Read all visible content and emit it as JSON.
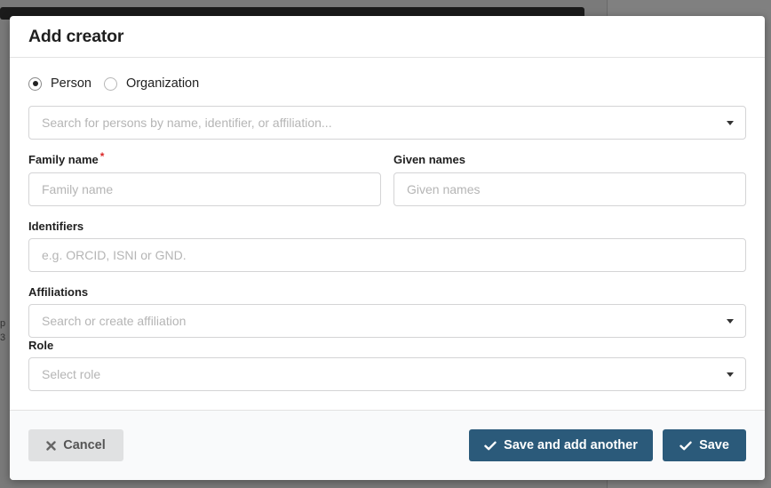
{
  "background": {
    "text_1": "p",
    "text_2": "3"
  },
  "modal": {
    "title": "Add creator",
    "type_options": [
      {
        "label": "Person",
        "checked": true
      },
      {
        "label": "Organization",
        "checked": false
      }
    ],
    "search": {
      "placeholder": "Search for persons by name, identifier, or affiliation..."
    },
    "family_name": {
      "label": "Family name",
      "required_mark": "*",
      "placeholder": "Family name"
    },
    "given_names": {
      "label": "Given names",
      "placeholder": "Given names"
    },
    "identifiers": {
      "label": "Identifiers",
      "placeholder": "e.g. ORCID, ISNI or GND."
    },
    "affiliations": {
      "label": "Affiliations",
      "placeholder": "Search or create affiliation"
    },
    "role": {
      "label": "Role",
      "placeholder": "Select role"
    }
  },
  "footer": {
    "cancel_label": "Cancel",
    "save_add_label": "Save and add another",
    "save_label": "Save"
  },
  "colors": {
    "primary": "#2b5a7a",
    "cancel_bg": "#e0e1e2",
    "required": "#db2828"
  },
  "icons": {
    "cancel": "close-icon",
    "save": "checkmark-icon",
    "dropdown": "caret-down-icon"
  }
}
